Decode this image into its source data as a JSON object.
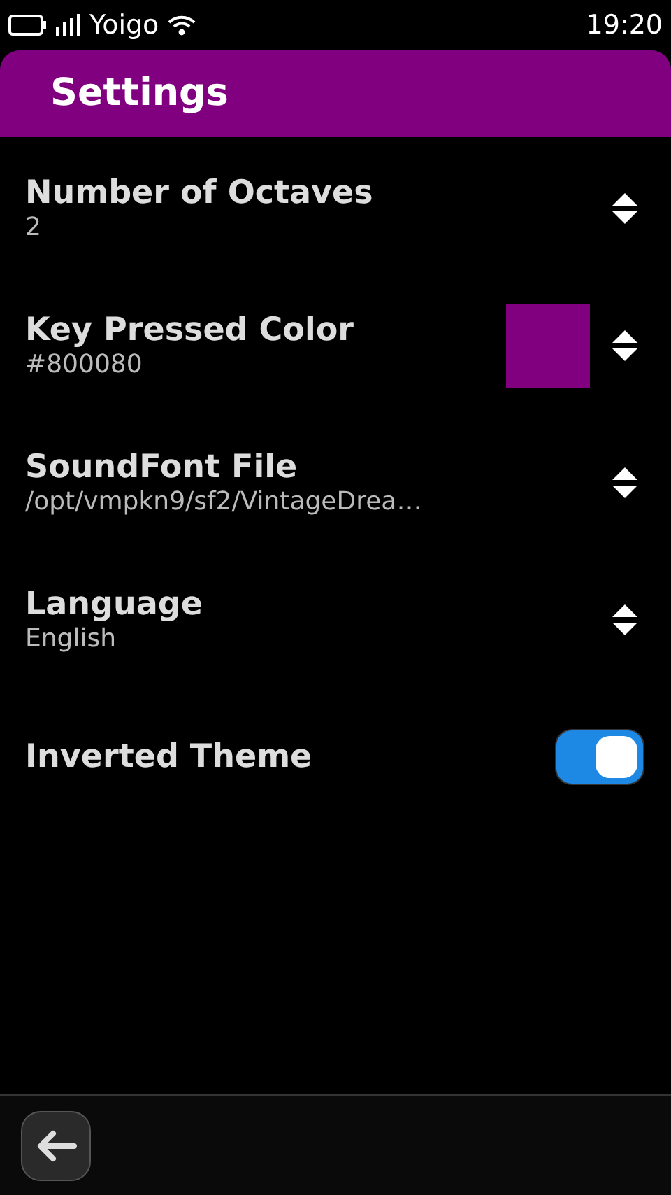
{
  "status_bar": {
    "carrier": "Yoigo",
    "time": "19:20"
  },
  "header": {
    "title": "Settings"
  },
  "settings": [
    {
      "kind": "selector",
      "title": "Number of Octaves",
      "value": "2"
    },
    {
      "kind": "selector",
      "title": "Key Pressed Color",
      "value": "#800080",
      "color": "#800080"
    },
    {
      "kind": "selector",
      "title": "SoundFont File",
      "value": "/opt/vmpkn9/sf2/VintageDrea…"
    },
    {
      "kind": "selector",
      "title": "Language",
      "value": "English"
    },
    {
      "kind": "switch",
      "title": "Inverted Theme",
      "on": true
    }
  ]
}
